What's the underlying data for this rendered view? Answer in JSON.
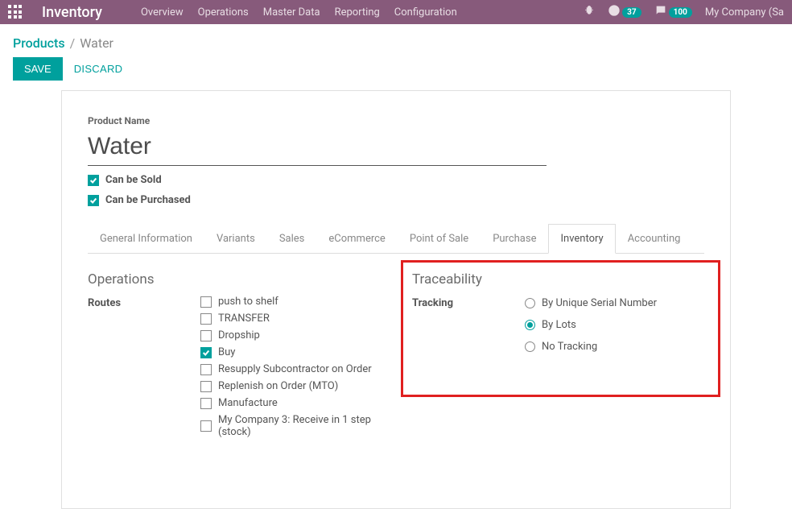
{
  "topbar": {
    "brand": "Inventory",
    "nav": [
      "Overview",
      "Operations",
      "Master Data",
      "Reporting",
      "Configuration"
    ],
    "clock_badge": "37",
    "chat_badge": "100",
    "company": "My Company (Sa"
  },
  "breadcrumb": {
    "parent": "Products",
    "current": "Water"
  },
  "actions": {
    "save": "SAVE",
    "discard": "DISCARD"
  },
  "form": {
    "product_name_label": "Product Name",
    "product_name": "Water",
    "can_be_sold": "Can be Sold",
    "can_be_purchased": "Can be Purchased"
  },
  "tabs": [
    "General Information",
    "Variants",
    "Sales",
    "eCommerce",
    "Point of Sale",
    "Purchase",
    "Inventory",
    "Accounting"
  ],
  "active_tab_index": 6,
  "operations": {
    "heading": "Operations",
    "routes_label": "Routes",
    "routes": [
      {
        "label": "push to shelf",
        "checked": false
      },
      {
        "label": "TRANSFER",
        "checked": false
      },
      {
        "label": "Dropship",
        "checked": false
      },
      {
        "label": "Buy",
        "checked": true
      },
      {
        "label": "Resupply Subcontractor on Order",
        "checked": false
      },
      {
        "label": "Replenish on Order (MTO)",
        "checked": false
      },
      {
        "label": "Manufacture",
        "checked": false
      },
      {
        "label": "My Company 3: Receive in 1 step (stock)",
        "checked": false
      }
    ]
  },
  "traceability": {
    "heading": "Traceability",
    "tracking_label": "Tracking",
    "options": [
      {
        "label": "By Unique Serial Number",
        "selected": false
      },
      {
        "label": "By Lots",
        "selected": true
      },
      {
        "label": "No Tracking",
        "selected": false
      }
    ]
  }
}
